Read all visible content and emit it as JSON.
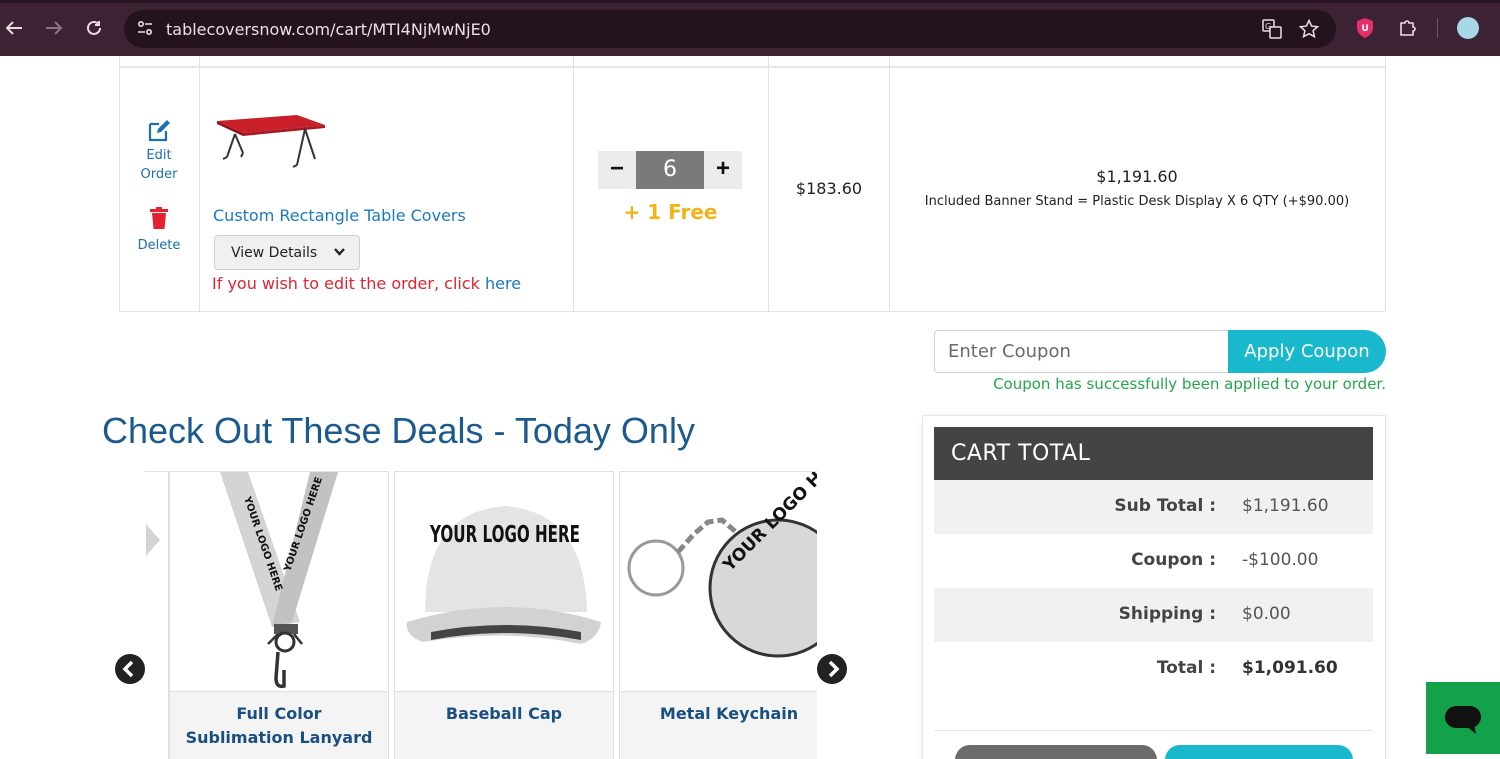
{
  "browser": {
    "url": "tablecoversnow.com/cart/MTI4NjMwNjE0"
  },
  "cart": {
    "edit_label_1": "Edit",
    "edit_label_2": "Order",
    "delete_label": "Delete",
    "product_name": "Custom Rectangle Table Covers",
    "view_details_label": "View Details",
    "edit_note_text": "If you wish to edit the order, click ",
    "edit_note_link": "here",
    "quantity": "6",
    "minus_label": "−",
    "plus_label": "+",
    "free_text": "+ 1 Free",
    "unit_price": "$183.60",
    "line_total": "$1,191.60",
    "line_note": "Included Banner Stand = Plastic Desk Display X 6 QTY (+$90.00)"
  },
  "coupon": {
    "placeholder": "Enter Coupon",
    "button_label": "Apply Coupon",
    "success_message": "Coupon has successfully been applied to your order."
  },
  "deals": {
    "title": "Check Out These Deals - Today Only",
    "cards": [
      {
        "name_line1": "Full Color",
        "name_line2": "Sublimation Lanyard",
        "print_text": "YOUR LOGO HERE"
      },
      {
        "name_line1": "Baseball Cap",
        "name_line2": "",
        "print_text": "YOUR LOGO HERE"
      },
      {
        "name_line1": "Metal Keychain",
        "name_line2": "",
        "print_text": "YOUR LOGO HERE"
      }
    ]
  },
  "cart_total": {
    "title": "CART  TOTAL",
    "rows": [
      {
        "label": "Sub Total :",
        "value": "$1,191.60"
      },
      {
        "label": "Coupon :",
        "value": "-$100.00"
      },
      {
        "label": "Shipping :",
        "value": "$0.00"
      },
      {
        "label": "Total :",
        "value": "$1,091.60"
      }
    ]
  },
  "colors": {
    "accent": "#19b8cc",
    "link": "#1a7abf",
    "error": "#e3232f",
    "success": "#22a84b",
    "free": "#f2b319",
    "chat": "#13a24a"
  }
}
